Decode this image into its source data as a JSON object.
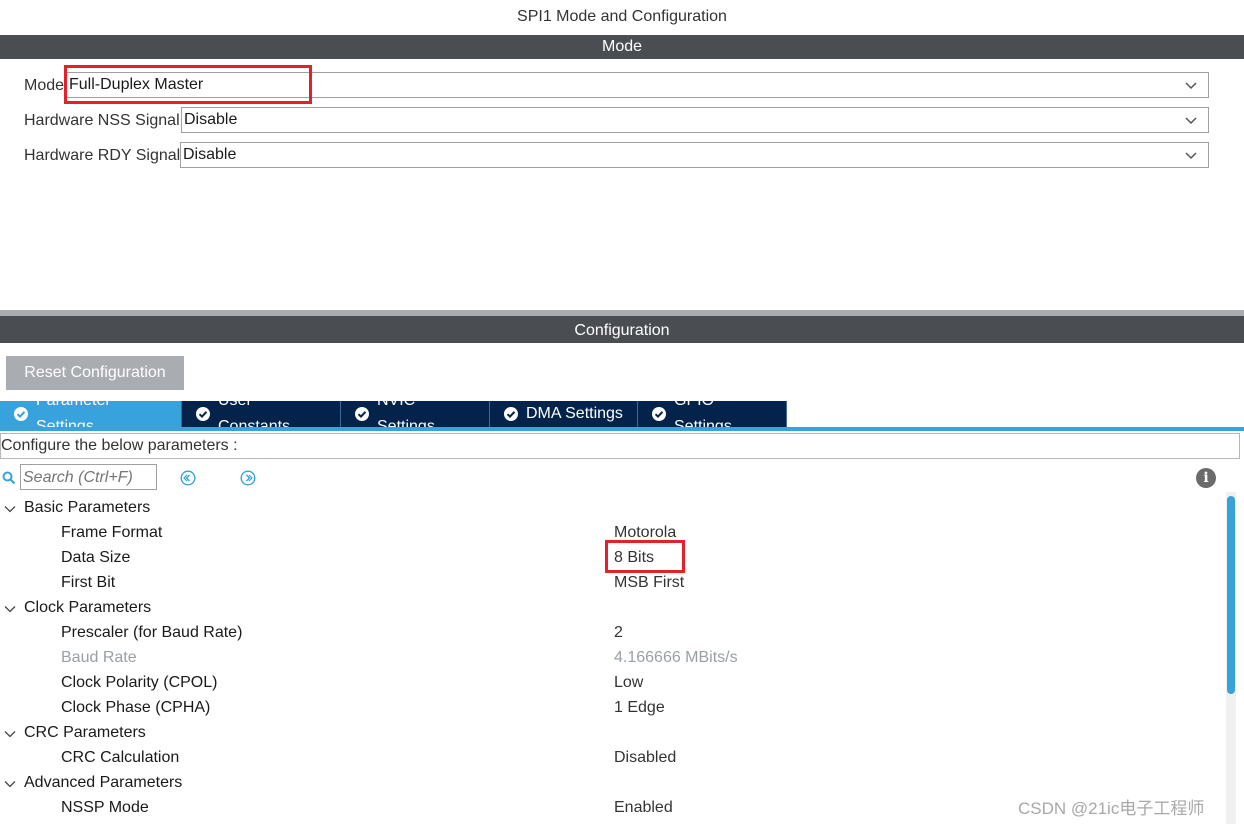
{
  "window": {
    "title": "SPI1 Mode and Configuration"
  },
  "mode_section": {
    "header": "Mode",
    "fields": [
      {
        "label": "Mode",
        "value": "Full-Duplex Master"
      },
      {
        "label": "Hardware NSS Signal",
        "value": "Disable"
      },
      {
        "label": "Hardware RDY Signal",
        "value": "Disable"
      }
    ]
  },
  "config_section": {
    "header": "Configuration",
    "reset_button": "Reset Configuration",
    "tabs": [
      {
        "label": "Parameter Settings",
        "active": true
      },
      {
        "label": "User Constants",
        "active": false
      },
      {
        "label": "NVIC Settings",
        "active": false
      },
      {
        "label": "DMA Settings",
        "active": false
      },
      {
        "label": "GPIO Settings",
        "active": false
      }
    ],
    "configure_text": "Configure the below parameters :",
    "search_placeholder": "Search (Ctrl+F)",
    "groups": [
      {
        "name": "Basic Parameters",
        "params": [
          {
            "name": "Frame Format",
            "value": "Motorola"
          },
          {
            "name": "Data Size",
            "value": "8 Bits"
          },
          {
            "name": "First Bit",
            "value": "MSB First"
          }
        ]
      },
      {
        "name": "Clock Parameters",
        "params": [
          {
            "name": "Prescaler (for Baud Rate)",
            "value": "2"
          },
          {
            "name": "Baud Rate",
            "value": "4.166666 MBits/s",
            "disabled": true
          },
          {
            "name": "Clock Polarity (CPOL)",
            "value": "Low"
          },
          {
            "name": "Clock Phase (CPHA)",
            "value": "1 Edge"
          }
        ]
      },
      {
        "name": "CRC Parameters",
        "params": [
          {
            "name": "CRC Calculation",
            "value": "Disabled"
          }
        ]
      },
      {
        "name": "Advanced Parameters",
        "params": [
          {
            "name": "NSSP Mode",
            "value": "Enabled"
          }
        ]
      }
    ]
  },
  "watermark": "CSDN @21ic电子工程师",
  "colors": {
    "header_bar": "#4a4e52",
    "tab_active": "#38a2dc",
    "tab_inactive": "#03234b",
    "highlight_box": "#e5202a"
  }
}
